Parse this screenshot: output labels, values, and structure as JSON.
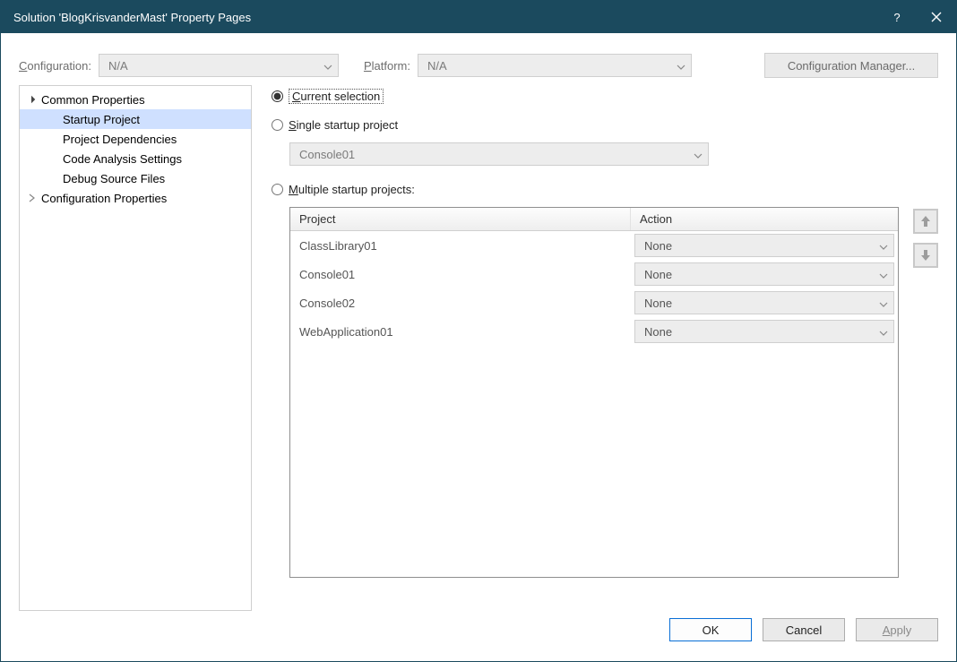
{
  "titlebar": {
    "title": "Solution 'BlogKrisvanderMast' Property Pages"
  },
  "configRow": {
    "configurationLabelPre": "C",
    "configurationLabelRest": "onfiguration:",
    "configurationValue": "N/A",
    "platformLabelPre": "P",
    "platformLabelRest": "latform:",
    "platformValue": "N/A",
    "configManagerBtn": "Configuration Manager..."
  },
  "tree": {
    "commonProperties": "Common Properties",
    "startupProject": "Startup Project",
    "projectDependencies": "Project Dependencies",
    "codeAnalysisSettings": "Code Analysis Settings",
    "debugSourceFiles": "Debug Source Files",
    "configurationProperties": "Configuration Properties"
  },
  "startup": {
    "currentSelectionPre": "C",
    "currentSelectionRest": "urrent selection",
    "singleStartupPre": "S",
    "singleStartupRest": "ingle startup project",
    "singleSelected": "Console01",
    "multipleStartupPre": "M",
    "multipleStartupRest": "ultiple startup projects:",
    "headers": {
      "project": "Project",
      "action": "Action"
    },
    "rows": [
      {
        "project": "ClassLibrary01",
        "action": "None"
      },
      {
        "project": "Console01",
        "action": "None"
      },
      {
        "project": "Console02",
        "action": "None"
      },
      {
        "project": "WebApplication01",
        "action": "None"
      }
    ]
  },
  "footer": {
    "ok": "OK",
    "cancel": "Cancel",
    "applyPre": "A",
    "applyRest": "pply"
  }
}
